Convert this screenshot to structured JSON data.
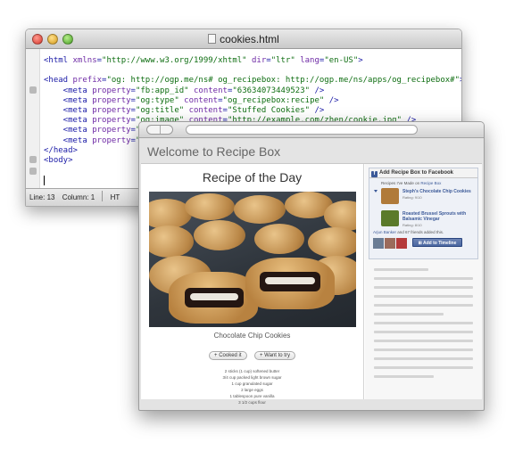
{
  "editor": {
    "title": "cookies.html",
    "code_lines": [
      [
        {
          "c": "tag",
          "t": "<html "
        },
        {
          "c": "attr",
          "t": "xmlns"
        },
        {
          "c": "tag",
          "t": "="
        },
        {
          "c": "val",
          "t": "\"http://www.w3.org/1999/xhtml\""
        },
        {
          "c": "tag",
          "t": " "
        },
        {
          "c": "attr",
          "t": "dir"
        },
        {
          "c": "tag",
          "t": "="
        },
        {
          "c": "val",
          "t": "\"ltr\""
        },
        {
          "c": "tag",
          "t": " "
        },
        {
          "c": "attr",
          "t": "lang"
        },
        {
          "c": "tag",
          "t": "="
        },
        {
          "c": "val",
          "t": "\"en-US\""
        },
        {
          "c": "tag",
          "t": ">"
        }
      ],
      [],
      [
        {
          "c": "tag",
          "t": "<head "
        },
        {
          "c": "attr",
          "t": "prefix"
        },
        {
          "c": "tag",
          "t": "="
        },
        {
          "c": "val",
          "t": "\"og: http://ogp.me/ns# og_recipebox: http://ogp.me/ns/apps/og_recipebox#\""
        },
        {
          "c": "tag",
          "t": ">"
        }
      ],
      [
        {
          "c": "tag",
          "t": "    <meta "
        },
        {
          "c": "attr",
          "t": "property"
        },
        {
          "c": "tag",
          "t": "="
        },
        {
          "c": "val",
          "t": "\"fb:app_id\""
        },
        {
          "c": "tag",
          "t": " "
        },
        {
          "c": "attr",
          "t": "content"
        },
        {
          "c": "tag",
          "t": "="
        },
        {
          "c": "val",
          "t": "\"63634073449523\""
        },
        {
          "c": "tag",
          "t": " />"
        }
      ],
      [
        {
          "c": "tag",
          "t": "    <meta "
        },
        {
          "c": "attr",
          "t": "property"
        },
        {
          "c": "tag",
          "t": "="
        },
        {
          "c": "val",
          "t": "\"og:type\""
        },
        {
          "c": "tag",
          "t": " "
        },
        {
          "c": "attr",
          "t": "content"
        },
        {
          "c": "tag",
          "t": "="
        },
        {
          "c": "val",
          "t": "\"og_recipebox:recipe\""
        },
        {
          "c": "tag",
          "t": " />"
        }
      ],
      [
        {
          "c": "tag",
          "t": "    <meta "
        },
        {
          "c": "attr",
          "t": "property"
        },
        {
          "c": "tag",
          "t": "="
        },
        {
          "c": "val",
          "t": "\"og:title\""
        },
        {
          "c": "tag",
          "t": " "
        },
        {
          "c": "attr",
          "t": "content"
        },
        {
          "c": "tag",
          "t": "="
        },
        {
          "c": "val",
          "t": "\"Stuffed Cookies\""
        },
        {
          "c": "tag",
          "t": " />"
        }
      ],
      [
        {
          "c": "tag",
          "t": "    <meta "
        },
        {
          "c": "attr",
          "t": "property"
        },
        {
          "c": "tag",
          "t": "="
        },
        {
          "c": "val",
          "t": "\"og:image\""
        },
        {
          "c": "tag",
          "t": " "
        },
        {
          "c": "attr",
          "t": "content"
        },
        {
          "c": "tag",
          "t": "="
        },
        {
          "c": "val",
          "t": "\"http://example.com/zhen/cookie.jpg\""
        },
        {
          "c": "tag",
          "t": " />"
        }
      ],
      [
        {
          "c": "tag",
          "t": "    <meta "
        },
        {
          "c": "attr",
          "t": "property"
        },
        {
          "c": "tag",
          "t": "="
        },
        {
          "c": "val",
          "t": "\"o"
        }
      ],
      [
        {
          "c": "tag",
          "t": "    <meta "
        },
        {
          "c": "attr",
          "t": "property"
        },
        {
          "c": "tag",
          "t": "="
        },
        {
          "c": "val",
          "t": "\"o"
        }
      ],
      [
        {
          "c": "tag",
          "t": "</head>"
        }
      ],
      [
        {
          "c": "tag",
          "t": "<body>"
        }
      ]
    ],
    "status": {
      "line": "Line: 13",
      "column": "Column: 1",
      "syntax": "HT"
    }
  },
  "browser": {
    "site_title": "Welcome to Recipe Box",
    "main": {
      "heading": "Recipe of the Day",
      "photo_caption": "Chocolate Chip Cookies",
      "cooked_button": "Cooked it",
      "want_button": "Want to try",
      "ingredients": [
        "2 sticks (1 cup) softened butter",
        "3/4 cup packed light brown sugar",
        "1 cup granulated sugar",
        "2 large eggs",
        "1 tablespoon pure vanilla",
        "3 1/2 cups flour"
      ]
    },
    "facebook": {
      "header": "Add Recipe Box to Facebook",
      "made_prefix": "Recipes I've Made on",
      "made_app": "Recipe Box",
      "recipes": [
        {
          "name": "Steph's Chocolate Chip Cookies",
          "sub": "Rating: 9/10",
          "color": "#b07a3a"
        },
        {
          "name": "Roasted Brussel Sprouts with Balsamic Vinegar",
          "sub": "Rating: 8/10",
          "color": "#5b7a2a"
        }
      ],
      "friends_name": "Arjun Banker",
      "friends_rest": "and 67 friends added this.",
      "timeline_button": "Add to Timeline",
      "brand_color": "#3b5998"
    }
  }
}
